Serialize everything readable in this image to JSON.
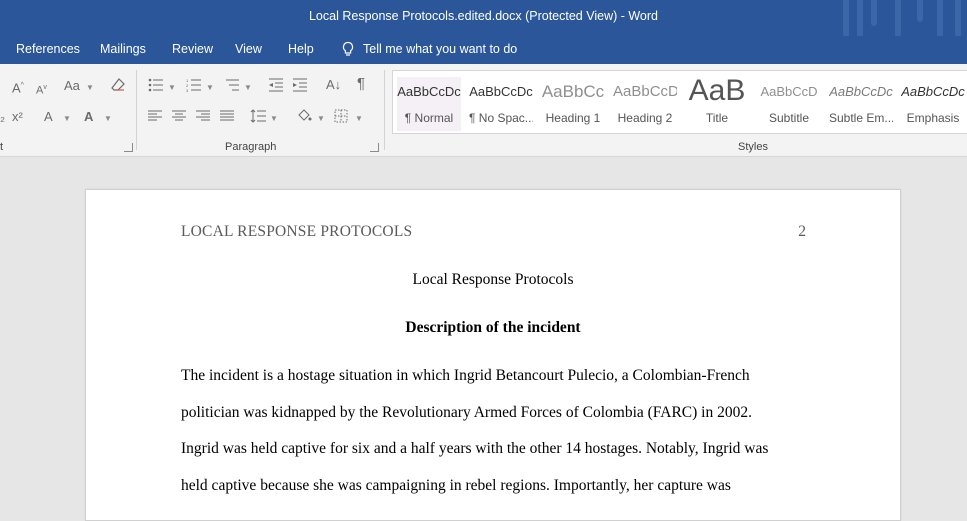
{
  "window": {
    "title": "Local Response Protocols.edited.docx (Protected View)  -  Word"
  },
  "menu": {
    "items": [
      "References",
      "Mailings",
      "Review",
      "View",
      "Help"
    ],
    "tell_me": "Tell me what you want to do"
  },
  "ribbon": {
    "groups": {
      "font_partial": "t",
      "paragraph": "Paragraph",
      "styles": "Styles"
    },
    "styles": [
      {
        "sample": "AaBbCcDc",
        "name": "¶ Normal"
      },
      {
        "sample": "AaBbCcDc",
        "name": "¶ No Spac..."
      },
      {
        "sample": "AaBbCc",
        "name": "Heading 1"
      },
      {
        "sample": "AaBbCcD",
        "name": "Heading 2"
      },
      {
        "sample": "AaB",
        "name": "Title"
      },
      {
        "sample": "AaBbCcD",
        "name": "Subtitle"
      },
      {
        "sample": "AaBbCcDc",
        "name": "Subtle Em..."
      },
      {
        "sample": "AaBbCcDc",
        "name": "Emphasis"
      }
    ],
    "font_glyphs": {
      "grow": "A",
      "shrink": "A",
      "case": "Aa",
      "superscript": "x²",
      "effects": "A",
      "color": "A"
    },
    "paragraph_glyphs": {
      "pilcrow": "¶",
      "sort": "A↓"
    }
  },
  "document": {
    "header_left": "LOCAL RESPONSE PROTOCOLS",
    "page_number": "2",
    "title": "Local Response Protocols",
    "heading": "Description of the incident",
    "lines": [
      "The incident is a hostage situation in which Ingrid Betancourt Pulecio, a Colombian-French",
      "politician was kidnapped by the Revolutionary Armed Forces of Colombia (FARC) in 2002.",
      "Ingrid was held captive for six and a half years with the other 14 hostages. Notably, Ingrid was",
      "held captive because she was campaigning in rebel regions. Importantly, her capture was"
    ]
  }
}
